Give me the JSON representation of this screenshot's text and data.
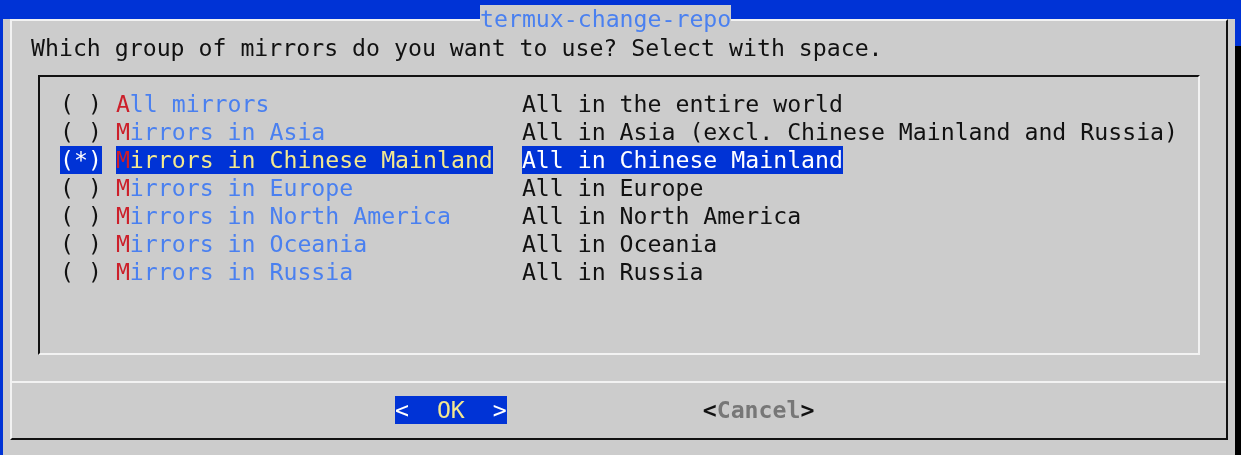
{
  "dialog": {
    "title": "termux-change-repo",
    "prompt": "Which group of mirrors do you want to use? Select with space.",
    "items": [
      {
        "marker": "( )",
        "tag": "All mirrors",
        "description": "All in the entire world",
        "selected": false
      },
      {
        "marker": "( )",
        "tag": "Mirrors in Asia",
        "description": "All in Asia (excl. Chinese Mainland and Russia)",
        "selected": false
      },
      {
        "marker": "(*)",
        "tag": "Mirrors in Chinese Mainland",
        "description": "All in Chinese Mainland",
        "selected": true
      },
      {
        "marker": "( )",
        "tag": "Mirrors in Europe",
        "description": "All in Europe",
        "selected": false
      },
      {
        "marker": "( )",
        "tag": "Mirrors in North America",
        "description": "All in North America",
        "selected": false
      },
      {
        "marker": "( )",
        "tag": "Mirrors in Oceania",
        "description": "All in Oceania",
        "selected": false
      },
      {
        "marker": "( )",
        "tag": "Mirrors in Russia",
        "description": "All in Russia",
        "selected": false
      }
    ],
    "buttons": [
      {
        "label": "<  OK  >",
        "selected": true
      },
      {
        "label": "<Cancel>",
        "selected": false
      }
    ]
  }
}
